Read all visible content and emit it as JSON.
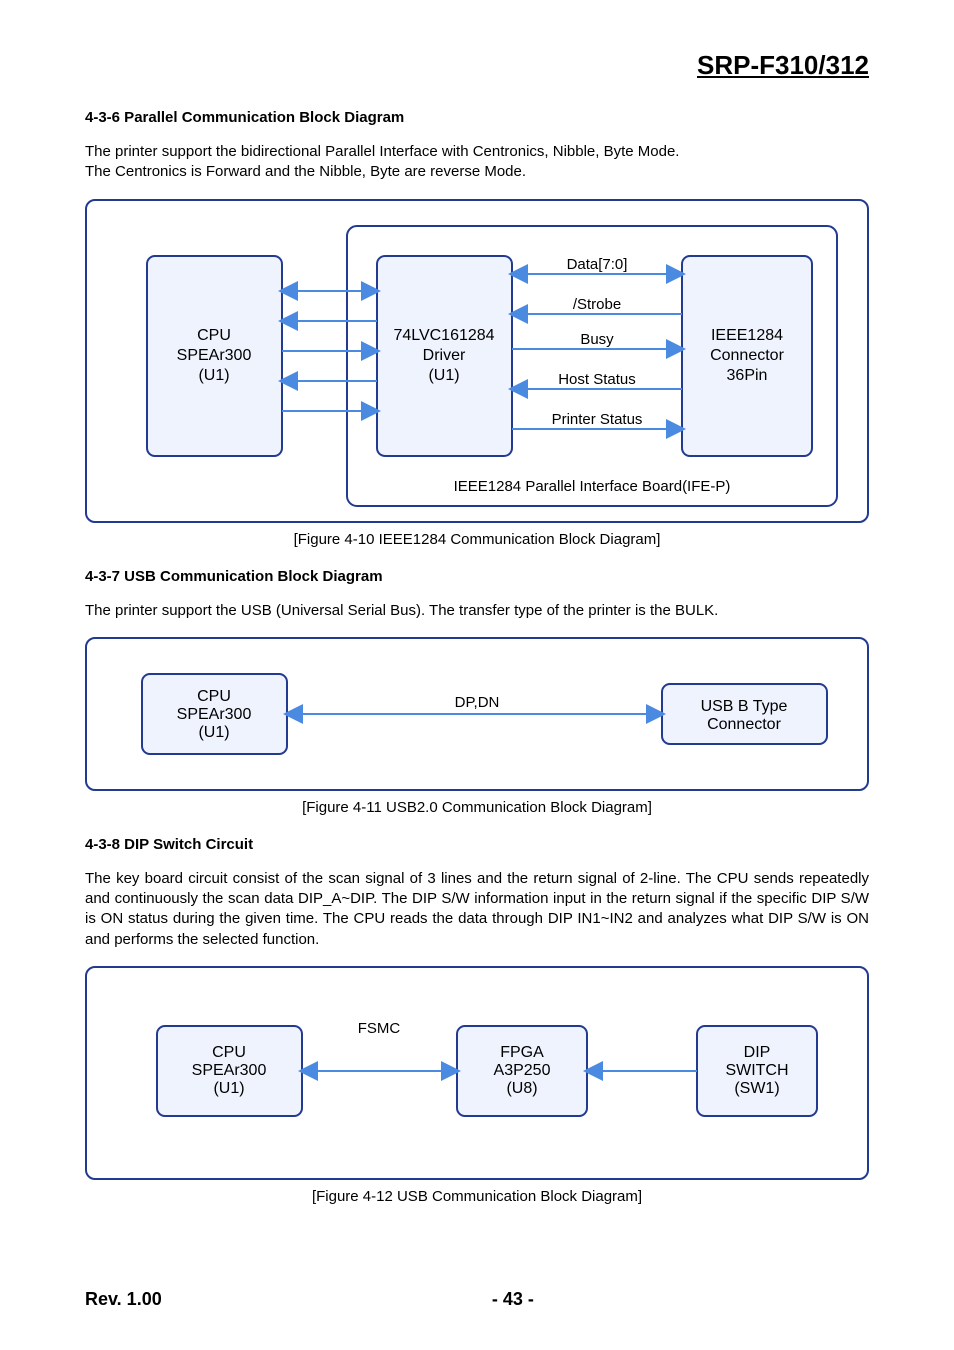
{
  "doc": {
    "model": "SRP-F310/312",
    "revision": "Rev. 1.00",
    "page": "- 43 -"
  },
  "sections": {
    "s436": {
      "heading": "4-3-6 Parallel Communication Block Diagram",
      "p1": "The printer support the bidirectional Parallel Interface with Centronics, Nibble, Byte Mode.",
      "p2": "The Centronics is Forward and the Nibble, Byte are reverse Mode.",
      "caption": "[Figure 4-10 IEEE1284 Communication Block Diagram]"
    },
    "s437": {
      "heading": "4-3-7 USB Communication Block Diagram",
      "p1": "The printer support the USB (Universal Serial Bus). The transfer type of the printer is the BULK.",
      "caption": "[Figure 4-11 USB2.0 Communication Block Diagram]"
    },
    "s438": {
      "heading": "4-3-8 DIP Switch Circuit",
      "p1": "The key board circuit consist of the scan signal of 3 lines and the return signal of 2-line. The CPU sends repeatedly and continuously the scan data DIP_A~DIP. The DIP S/W information input in the return signal if the specific DIP S/W is ON status during the given time. The CPU reads the data through DIP IN1~IN2 and analyzes what DIP S/W is ON and performs the selected function.",
      "caption": "[Figure 4-12 USB Communication Block Diagram]"
    }
  },
  "diag1": {
    "cpu": {
      "l1": "CPU",
      "l2": "SPEAr300",
      "l3": "(U1)"
    },
    "driver": {
      "l1": "74LVC161284",
      "l2": "Driver",
      "l3": "(U1)"
    },
    "conn": {
      "l1": "IEEE1284",
      "l2": "Connector",
      "l3": "36Pin"
    },
    "signals": {
      "s1": "Data[7:0]",
      "s2": "/Strobe",
      "s3": "Busy",
      "s4": "Host Status",
      "s5": "Printer Status"
    },
    "board": "IEEE1284 Parallel Interface Board(IFE-P)"
  },
  "diag2": {
    "cpu": {
      "l1": "CPU",
      "l2": "SPEAr300",
      "l3": "(U1)"
    },
    "label": "DP,DN",
    "conn": {
      "l1": "USB B Type",
      "l2": "Connector"
    }
  },
  "diag3": {
    "cpu": {
      "l1": "CPU",
      "l2": "SPEAr300",
      "l3": "(U1)"
    },
    "label": "FSMC",
    "fpga": {
      "l1": "FPGA",
      "l2": "A3P250",
      "l3": "(U8)"
    },
    "dip": {
      "l1": "DIP",
      "l2": "SWITCH",
      "l3": "(SW1)"
    }
  }
}
